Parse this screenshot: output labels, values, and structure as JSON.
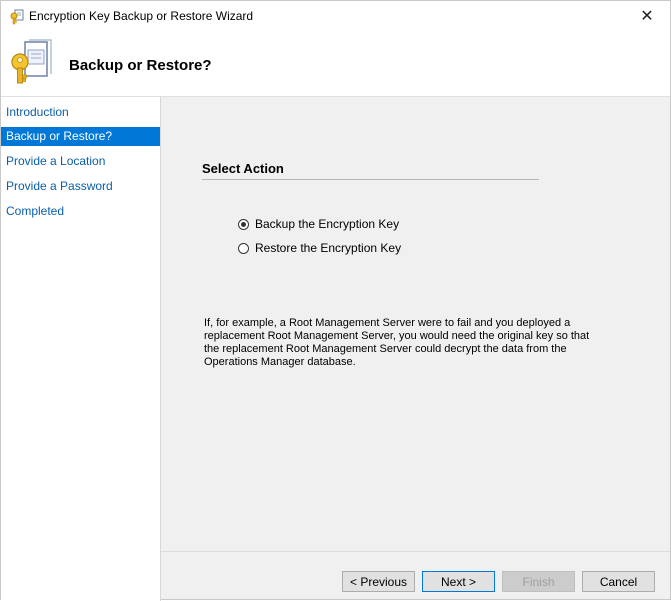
{
  "window": {
    "title": "Encryption Key Backup or Restore Wizard",
    "close_glyph": "✕",
    "icon": "key-certificate-icon"
  },
  "header": {
    "title": "Backup or Restore?",
    "icon": "key-certificate-icon"
  },
  "nav": {
    "items": [
      {
        "label": "Introduction",
        "active": false
      },
      {
        "label": "Backup or Restore?",
        "active": true
      },
      {
        "label": "Provide a Location",
        "active": false
      },
      {
        "label": "Provide a Password",
        "active": false
      },
      {
        "label": "Completed",
        "active": false
      }
    ]
  },
  "main": {
    "section_title": "Select Action",
    "options": [
      {
        "label": "Backup the Encryption Key",
        "checked": true
      },
      {
        "label": "Restore the Encryption Key",
        "checked": false
      }
    ],
    "info_text": "If, for example, a Root Management Server were to fail and you deployed a replacement Root Management Server, you would need the original key so that the replacement Root Management Server could decrypt the data from the Operations Manager database."
  },
  "footer": {
    "previous_label": "< Previous",
    "next_label": "Next >",
    "finish_label": "Finish",
    "cancel_label": "Cancel"
  },
  "colors": {
    "accent": "#0078d7",
    "nav_link": "#0a5fa8",
    "panel_bg": "#f0f0f0"
  }
}
